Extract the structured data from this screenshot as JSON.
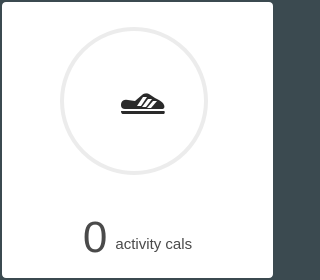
{
  "card": {
    "icon": "shoe-icon",
    "value": "0",
    "label": "activity cals"
  },
  "colors": {
    "background": "#3b4a50",
    "card": "#ffffff",
    "ring": "#ececec",
    "text": "#4a4a4a"
  }
}
